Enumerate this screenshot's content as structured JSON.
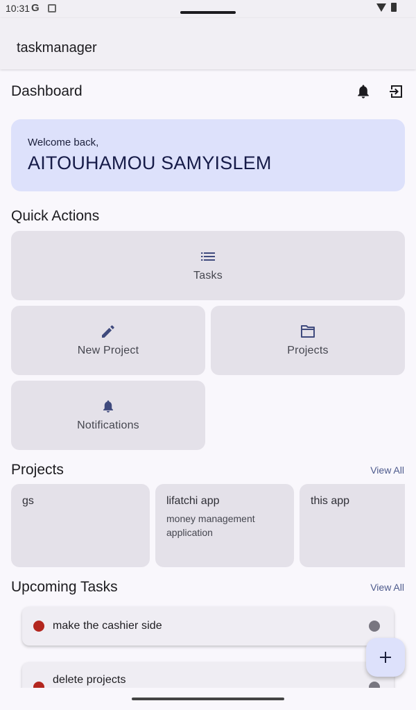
{
  "status_bar": {
    "time": "10:31",
    "google_glyph": "G"
  },
  "app_bar": {
    "title": "taskmanager"
  },
  "dashboard": {
    "title": "Dashboard",
    "icons": [
      "bell-icon",
      "logout-icon"
    ]
  },
  "welcome": {
    "label": "Welcome back,",
    "name": "AITOUHAMOU SAMYISLEM"
  },
  "quick_actions": {
    "title": "Quick Actions",
    "items": [
      {
        "label": "Tasks",
        "icon": "list-icon"
      },
      {
        "label": "New Project",
        "icon": "pencil-icon"
      },
      {
        "label": "Projects",
        "icon": "folder-icon"
      },
      {
        "label": "Notifications",
        "icon": "bell-icon"
      }
    ]
  },
  "projects": {
    "title": "Projects",
    "view_all": "View All",
    "items": [
      {
        "name": "gs",
        "description": ""
      },
      {
        "name": "lifatchi app",
        "description": "money management application"
      },
      {
        "name": "this app",
        "description": ""
      }
    ]
  },
  "upcoming_tasks": {
    "title": "Upcoming Tasks",
    "view_all": "View All",
    "items": [
      {
        "title": "make the cashier side"
      },
      {
        "title": "delete projects"
      }
    ]
  },
  "colors": {
    "accent_container": "#dde1fb",
    "priority_high": "#b3261e",
    "status_pending": "#787680",
    "primary": "#4d5a8c"
  }
}
